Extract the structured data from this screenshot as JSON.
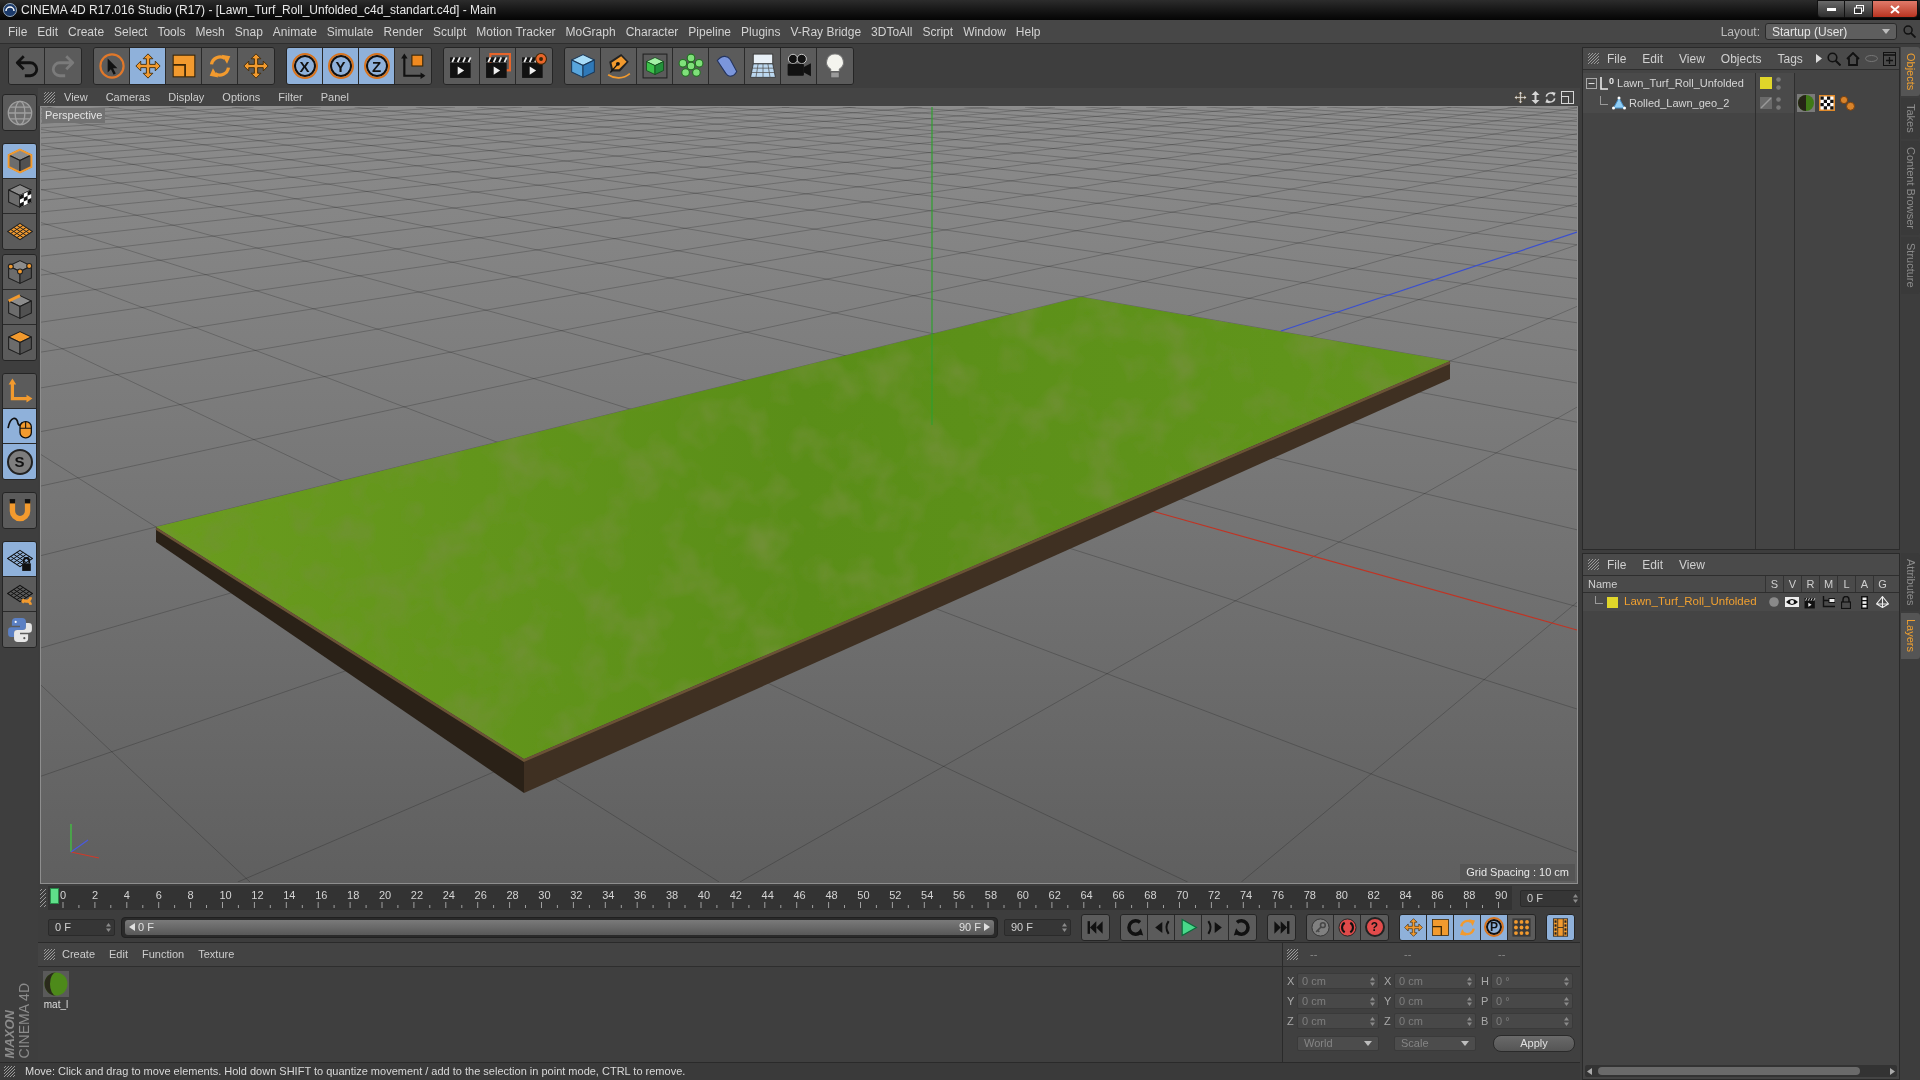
{
  "window": {
    "title": "CINEMA 4D R17.016 Studio (R17) - [Lawn_Turf_Roll_Unfolded_c4d_standart.c4d] - Main"
  },
  "menu_bar": {
    "items": [
      "File",
      "Edit",
      "Create",
      "Select",
      "Tools",
      "Mesh",
      "Snap",
      "Animate",
      "Simulate",
      "Render",
      "Sculpt",
      "Motion Tracker",
      "MoGraph",
      "Character",
      "Pipeline",
      "Plugins",
      "V-Ray Bridge",
      "3DToAll",
      "Script",
      "Window",
      "Help"
    ],
    "layout_label": "Layout:",
    "layout_value": "Startup (User)"
  },
  "toolbar": {
    "history": [
      {
        "kind": "undo",
        "disabled": false
      },
      {
        "kind": "redo",
        "disabled": true
      }
    ],
    "tool_groups": [
      [
        {
          "kind": "live-select",
          "active": false
        },
        {
          "kind": "move",
          "active": true
        },
        {
          "kind": "scale",
          "active": false
        },
        {
          "kind": "rotate",
          "active": false
        },
        {
          "kind": "last-tool",
          "active": false
        }
      ],
      [
        {
          "kind": "axis",
          "label": "X",
          "active": true
        },
        {
          "kind": "axis",
          "label": "Y",
          "active": true
        },
        {
          "kind": "axis",
          "label": "Z",
          "active": true
        },
        {
          "kind": "world-coords",
          "active": false
        }
      ]
    ],
    "create_groups": [
      [
        {
          "kind": "render-view"
        },
        {
          "kind": "render-picture"
        },
        {
          "kind": "render-settings"
        }
      ],
      [
        {
          "kind": "cube"
        },
        {
          "kind": "pen"
        },
        {
          "kind": "subdivision"
        },
        {
          "kind": "cloner"
        },
        {
          "kind": "bend"
        },
        {
          "kind": "floor"
        },
        {
          "kind": "camera"
        },
        {
          "kind": "light"
        }
      ]
    ]
  },
  "left_tools": {
    "groups": [
      [
        {
          "kind": "make-editable",
          "active": false
        }
      ],
      [
        {
          "kind": "model-mode",
          "active": true
        },
        {
          "kind": "texture-mode",
          "active": false
        },
        {
          "kind": "workplane-mode",
          "active": false
        }
      ],
      [
        {
          "kind": "points-mode",
          "active": false
        },
        {
          "kind": "edges-mode",
          "active": false
        },
        {
          "kind": "polygons-mode",
          "active": false
        }
      ],
      [
        {
          "kind": "axis-mode",
          "active": false
        },
        {
          "kind": "tweak-mode",
          "active": true
        },
        {
          "kind": "snap",
          "label": "S",
          "active": true
        }
      ],
      [
        {
          "kind": "magnet",
          "active": false
        }
      ],
      [
        {
          "kind": "locked-workplane",
          "active": true
        },
        {
          "kind": "workplane-rotate",
          "active": false
        },
        {
          "kind": "python",
          "active": false
        }
      ]
    ]
  },
  "viewport": {
    "menu": [
      "View",
      "Cameras",
      "Display",
      "Options",
      "Filter",
      "Panel"
    ],
    "camera": "Perspective",
    "grid_spacing": "Grid Spacing : 10 cm"
  },
  "timeline": {
    "ticks": [
      "0",
      "2",
      "4",
      "6",
      "8",
      "10",
      "12",
      "14",
      "16",
      "18",
      "20",
      "22",
      "24",
      "26",
      "28",
      "30",
      "32",
      "34",
      "36",
      "38",
      "40",
      "42",
      "44",
      "46",
      "48",
      "50",
      "52",
      "54",
      "56",
      "58",
      "60",
      "62",
      "64",
      "66",
      "68",
      "70",
      "72",
      "74",
      "76",
      "78",
      "80",
      "82",
      "84",
      "86",
      "88",
      "90"
    ],
    "playhead": {
      "level": 0
    },
    "current_frame": "0 F",
    "start_frame": "0 F",
    "range": {
      "start": "0 F",
      "end": "90 F",
      "level": 1
    },
    "end_frame": "90 F",
    "transport": [
      {
        "kind": "go-start"
      },
      {
        "kind": "prev-key"
      },
      {
        "kind": "prev-frame"
      },
      {
        "kind": "play"
      },
      {
        "kind": "next-frame"
      },
      {
        "kind": "next-key"
      },
      {
        "kind": "go-end"
      }
    ],
    "record": [
      {
        "kind": "keyframe",
        "disabled": true
      },
      {
        "kind": "autokey",
        "disabled": false
      },
      {
        "kind": "keyframe-selection",
        "label": "?",
        "disabled": false
      }
    ],
    "modes": [
      {
        "kind": "position",
        "active": true
      },
      {
        "kind": "scale",
        "active": true
      },
      {
        "kind": "rotation",
        "active": true
      },
      {
        "kind": "parameter",
        "label": "P",
        "active": true
      },
      {
        "kind": "point-level",
        "active": false
      }
    ],
    "timeline_button": {
      "kind": "film-strip",
      "active": true
    }
  },
  "material_manager": {
    "menu": [
      "Create",
      "Edit",
      "Function",
      "Texture"
    ],
    "materials": [
      {
        "name": "mat_l"
      }
    ]
  },
  "coordinates": {
    "headers": [
      "--",
      "--",
      "--"
    ],
    "columns": [
      [
        {
          "axis": "X",
          "value": "0 cm"
        },
        {
          "axis": "Y",
          "value": "0 cm"
        },
        {
          "axis": "Z",
          "value": "0 cm"
        }
      ],
      [
        {
          "axis": "X",
          "value": "0 cm"
        },
        {
          "axis": "Y",
          "value": "0 cm"
        },
        {
          "axis": "Z",
          "value": "0 cm"
        }
      ],
      [
        {
          "axis": "H",
          "value": "0 °"
        },
        {
          "axis": "P",
          "value": "0 °"
        },
        {
          "axis": "B",
          "value": "0 °"
        }
      ]
    ],
    "dropdowns": [
      "World",
      "Scale"
    ],
    "apply": "Apply"
  },
  "status_bar": {
    "text": "Move: Click and drag to move elements. Hold down SHIFT to quantize movement / add to the selection in point mode, CTRL to remove."
  },
  "logo": {
    "brand": "MAXON",
    "product": "CINEMA 4D"
  },
  "object_manager": {
    "menu": [
      "File",
      "Edit",
      "View",
      "Objects",
      "Tags"
    ],
    "tree": [
      {
        "name": "Lawn_Turf_Roll_Unfolded",
        "kind": "null",
        "icon_label": "0",
        "color": "#e0d62a",
        "expanded": true,
        "children": [
          {
            "name": "Rolled_Lawn_geo_2",
            "kind": "polygon",
            "tags": [
              {
                "kind": "material"
              },
              {
                "kind": "texture"
              },
              {
                "kind": "points"
              }
            ]
          }
        ]
      }
    ]
  },
  "layer_manager": {
    "menu": [
      "File",
      "Edit",
      "View"
    ],
    "columns": [
      "Name",
      "S",
      "V",
      "R",
      "M",
      "L",
      "A",
      "G"
    ],
    "layers": [
      {
        "name": "Lawn_Turf_Roll_Unfolded",
        "color": "#e0d62a"
      }
    ]
  },
  "side_tabs": {
    "top": [
      {
        "label": "Objects",
        "selected": true
      },
      {
        "label": "Takes",
        "selected": false
      },
      {
        "label": "Content Browser",
        "selected": false
      },
      {
        "label": "Structure",
        "selected": false
      }
    ],
    "bottom": [
      {
        "label": "Attributes",
        "selected": false
      },
      {
        "label": "Layers",
        "selected": true
      }
    ]
  }
}
